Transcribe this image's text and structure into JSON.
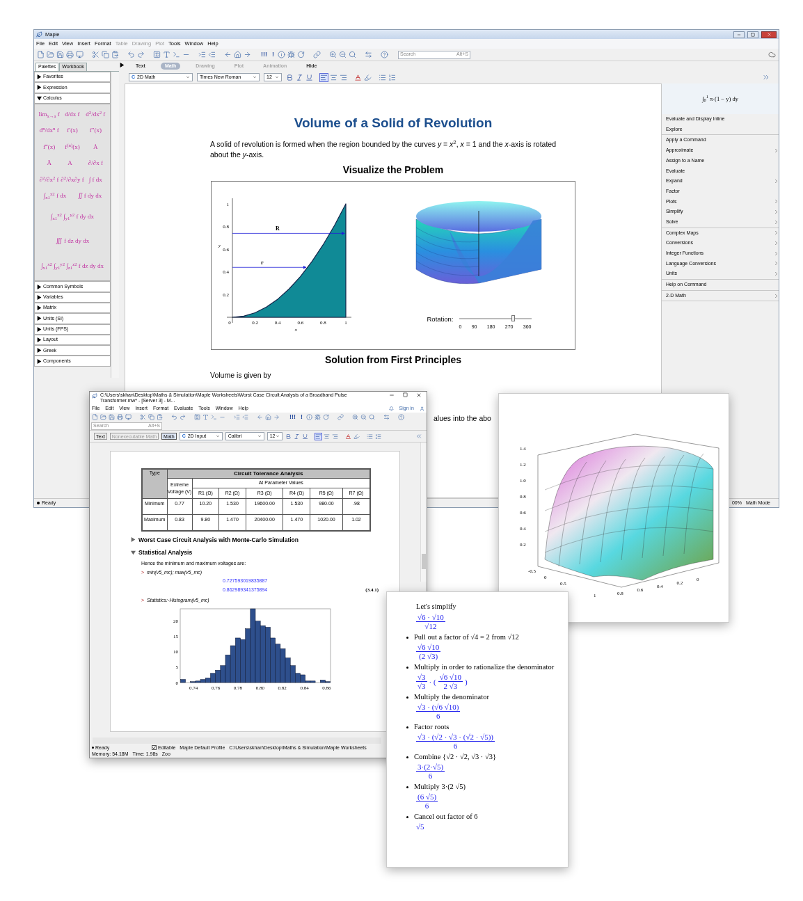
{
  "main_window": {
    "title": "Maple",
    "menu": [
      {
        "label": "File",
        "disabled": false
      },
      {
        "label": "Edit",
        "disabled": false
      },
      {
        "label": "View",
        "disabled": false
      },
      {
        "label": "Insert",
        "disabled": false
      },
      {
        "label": "Format",
        "disabled": false
      },
      {
        "label": "Table",
        "disabled": true
      },
      {
        "label": "Drawing",
        "disabled": true
      },
      {
        "label": "Plot",
        "disabled": true
      },
      {
        "label": "Tools",
        "disabled": false
      },
      {
        "label": "Window",
        "disabled": false
      },
      {
        "label": "Help",
        "disabled": false
      }
    ],
    "toolbar_glyphs": [
      "!!!",
      "!"
    ],
    "search": {
      "placeholder": "Search",
      "shortcut": "Alt+S"
    },
    "panel_tabs": [
      {
        "label": "Palettes",
        "selected": true
      },
      {
        "label": "Workbook",
        "selected": false
      }
    ],
    "mode_tabs": [
      {
        "label": "Text",
        "selected": false,
        "disabled": false
      },
      {
        "label": "Math",
        "selected": true,
        "disabled": false
      },
      {
        "label": "Drawing",
        "selected": false,
        "disabled": true
      },
      {
        "label": "Plot",
        "selected": false,
        "disabled": true
      },
      {
        "label": "Animation",
        "selected": false,
        "disabled": true
      },
      {
        "label": "Hide",
        "selected": false,
        "disabled": false
      }
    ],
    "format_bar": {
      "style_glyph": "C",
      "style": "2D Math",
      "font": "Times New Roman",
      "size": "12"
    },
    "palettes": [
      {
        "label": "Favorites",
        "expanded": false
      },
      {
        "label": "Expression",
        "expanded": false
      },
      {
        "label": "Calculus",
        "expanded": true,
        "items": [
          {
            "kind": "cell",
            "text": "lim$_{x→a}$ f"
          },
          {
            "kind": "cell",
            "text": "d/dx f"
          },
          {
            "kind": "cell",
            "text": "d$^{2}$/dx$^{2}$ f"
          },
          {
            "kind": "cell",
            "text": "d$^{n}$/dx$^{n}$ f"
          },
          {
            "kind": "cell",
            "text": "f′(x)"
          },
          {
            "kind": "cell",
            "text": "f″(x)"
          },
          {
            "kind": "cell",
            "text": "f‴(x)"
          },
          {
            "kind": "cell",
            "text": "f$^{(n)}$(x)"
          },
          {
            "kind": "cell",
            "text": "Ȧ"
          },
          {
            "kind": "cell",
            "text": "Ä"
          },
          {
            "kind": "cell",
            "text": "A⃛"
          },
          {
            "kind": "cell",
            "text": "∂/∂x f"
          },
          {
            "kind": "cell",
            "text": "∂$^{2}$/∂x$^{2}$ f"
          },
          {
            "kind": "cell",
            "text": "∂$^{2}$/∂x∂y f"
          },
          {
            "kind": "cell",
            "text": "∫ f dx"
          },
          {
            "kind": "half",
            "text": "∫$_{x1}$$^{x2}$ f dx"
          },
          {
            "kind": "half",
            "text": "∬ f dy dx"
          },
          {
            "kind": "wide",
            "text": "∫$_{x1}$$^{x2}$ ∫$_{y1}$$^{y2}$ f dy dx"
          },
          {
            "kind": "wide",
            "text": "∭ f dz dy dx"
          },
          {
            "kind": "wide",
            "text": "∫$_{x1}$$^{x2}$ ∫$_{y1}$$^{y2}$ ∫$_{z1}$$^{z2}$ f dz dy dx"
          }
        ]
      },
      {
        "label": "Common Symbols",
        "expanded": false
      },
      {
        "label": "Variables",
        "expanded": false
      },
      {
        "label": "Matrix",
        "expanded": false
      },
      {
        "label": "Units (SI)",
        "expanded": false
      },
      {
        "label": "Units (FPS)",
        "expanded": false
      },
      {
        "label": "Layout",
        "expanded": false
      },
      {
        "label": "Greek",
        "expanded": false
      },
      {
        "label": "Components",
        "expanded": false
      }
    ],
    "document": {
      "title": "Volume of a Solid of Revolution",
      "paragraph": "A solid of revolution is formed when the region bounded by the curves *y* = *x*$^{2}$, *x* = 1 and the *x*-axis is rotated about the *y*-axis.",
      "heading_1": "Visualize the Problem",
      "plot_2d": {
        "chart_data": {
          "type": "area",
          "x": [
            0,
            0.1,
            0.2,
            0.3,
            0.4,
            0.5,
            0.6,
            0.7,
            0.8,
            0.9,
            1
          ],
          "values": [
            0,
            0.01,
            0.04,
            0.09,
            0.16,
            0.25,
            0.36,
            0.49,
            0.64,
            0.81,
            1
          ],
          "xlim": [
            0,
            1
          ],
          "ylim": [
            0,
            1
          ],
          "xlabel": "x",
          "ylabel": "y",
          "xticks": [
            0,
            0.2,
            0.4,
            0.6,
            0.8,
            1
          ],
          "yticks": [
            0.2,
            0.4,
            0.6,
            0.8,
            1
          ],
          "ref_lines": [
            {
              "axis": "y",
              "value": 0.74,
              "label": "R"
            },
            {
              "axis": "y",
              "value": 0.44,
              "label": "r"
            }
          ]
        }
      },
      "rotation": {
        "label": "Rotation:",
        "level": 0.75,
        "ticks": [
          "0",
          "90",
          "180",
          "270",
          "360"
        ]
      },
      "heading_2": "Solution from First Principles",
      "text_1": "Volume is given by",
      "text_2": "alues into the abo"
    },
    "context_panel": {
      "expression": "∫$_{0}$$^{1}$ π·(1 − y) dy",
      "groups": [
        [
          {
            "label": "Evaluate and Display Inline",
            "submenu": false
          },
          {
            "label": "Explore",
            "submenu": false
          }
        ],
        [
          {
            "label": "Apply a Command",
            "submenu": false
          },
          {
            "label": "Approximate",
            "submenu": true
          },
          {
            "label": "Assign to a Name",
            "submenu": false
          },
          {
            "label": "Evaluate",
            "submenu": false
          },
          {
            "label": "Expand",
            "submenu": true
          },
          {
            "label": "Factor",
            "submenu": false
          },
          {
            "label": "Plots",
            "submenu": true
          },
          {
            "label": "Simplify",
            "submenu": true
          },
          {
            "label": "Solve",
            "submenu": true
          }
        ],
        [
          {
            "label": "Complex Maps",
            "submenu": true
          },
          {
            "label": "Conversions",
            "submenu": true
          },
          {
            "label": "Integer Functions",
            "submenu": true
          },
          {
            "label": "Language Conversions",
            "submenu": true
          },
          {
            "label": "Units",
            "submenu": true
          }
        ],
        [
          {
            "label": "Help on Command",
            "submenu": false
          }
        ],
        [
          {
            "label": "2-D Math",
            "submenu": true
          }
        ]
      ]
    },
    "status_bar": {
      "status": "Ready",
      "zoom": "00%",
      "mode": "Math Mode"
    }
  },
  "second_window": {
    "title": "C:\\Users\\skhan\\Desktop\\Maths & Simulation\\Maple Worksheets\\Worst Case Circuit Analysis of a Broadband Pulse Transformer.mw* - [Server 3] - M...",
    "menu": [
      "File",
      "Edit",
      "View",
      "Insert",
      "Format",
      "Evaluate",
      "Tools",
      "Window",
      "Help"
    ],
    "sign_in": "Sign in",
    "toolbar_glyphs": [
      "!!!",
      "!"
    ],
    "search": {
      "placeholder": "Search",
      "shortcut": "Alt+S"
    },
    "mode_buttons": [
      {
        "label": "Text",
        "selected": false,
        "disabled": false
      },
      {
        "label": "Nonexecutable Math",
        "selected": false,
        "disabled": true
      },
      {
        "label": "Math",
        "selected": true,
        "disabled": false
      }
    ],
    "format_bar": {
      "style_glyph": "C",
      "style": "2D Input",
      "font": "Calibri",
      "size": "12"
    },
    "table": {
      "type_header": "Type",
      "title": "Circuit Tolerance Analysis",
      "voltage_header": "Extreme Voltage (V)",
      "params_header": "At Parameter Values",
      "columns": [
        "R1 (Ω)",
        "R2 (Ω)",
        "R3 (Ω)",
        "R4 (Ω)",
        "R5 (Ω)",
        "R7 (Ω)"
      ],
      "rows": [
        {
          "label": "Minimum",
          "voltage": "0.77",
          "values": [
            "10.20",
            "1.530",
            "19600.00",
            "1.530",
            "980.00",
            ".98"
          ]
        },
        {
          "label": "Maximum",
          "voltage": "0.83",
          "values": [
            "9.80",
            "1.470",
            "20400.00",
            "1.470",
            "1020.00",
            "1.02"
          ]
        }
      ]
    },
    "sections": [
      {
        "title": "Worst Case Circuit Analysis with Monte-Carlo Simulation",
        "expanded": false
      },
      {
        "title": "Statistical Analysis",
        "expanded": true
      }
    ],
    "text": "Hence the minimum and maximum voltages are:",
    "command_1": {
      "prompt": ">",
      "code": "min(v5_mc); max(v5_mc)"
    },
    "outputs": [
      "0.727593019835887",
      "0.862989341375894"
    ],
    "equation_label": "(3.4.1)",
    "command_2": {
      "prompt": ">",
      "code": "Statistics:-Histogram(v5_mc)"
    },
    "histogram": {
      "chart_data": {
        "type": "bar",
        "x": [
          0.7305,
          0.735,
          0.7395,
          0.744,
          0.7485,
          0.753,
          0.7575,
          0.762,
          0.7665,
          0.771,
          0.7755,
          0.78,
          0.7845,
          0.789,
          0.7935,
          0.798,
          0.8025,
          0.807,
          0.8115,
          0.816,
          0.8205,
          0.825,
          0.8295,
          0.834,
          0.8385,
          0.843,
          0.8475,
          0.852,
          0.8565,
          0.861
        ],
        "values": [
          1,
          0,
          0.3,
          0.5,
          1,
          1.5,
          3,
          4,
          5.5,
          9,
          12,
          14.5,
          14,
          17.5,
          24,
          20,
          18.5,
          18,
          14.5,
          12.5,
          11,
          8,
          5.5,
          3,
          2.5,
          0.5,
          0.5,
          0,
          0.8,
          0.3
        ],
        "xlim": [
          0.728,
          0.8635
        ],
        "ylim": [
          0,
          24
        ],
        "xticks": [
          {
            "value": 0.74,
            "label": "0.74"
          },
          {
            "value": 0.76,
            "label": "0.76"
          },
          {
            "value": 0.78,
            "label": "0.78"
          },
          {
            "value": 0.8,
            "label": "0.80"
          },
          {
            "value": 0.82,
            "label": "0.82"
          },
          {
            "value": 0.84,
            "label": "0.84"
          },
          {
            "value": 0.86,
            "label": "0.86"
          }
        ],
        "yticks": [
          0,
          5,
          10,
          15,
          20
        ]
      }
    },
    "status_bar": {
      "status": "Ready",
      "editable": {
        "label": "Editable",
        "checked": true
      },
      "profile": "Maple Default Profile",
      "path": "C:\\Users\\skhan\\Desktop\\Maths & Simulation\\Maple Worksheets",
      "memory": "Memory: 54.18M",
      "time": "Time: 1.98s",
      "zoom": "Zoo"
    }
  },
  "plot_3d": {
    "z_ticks": [
      "1.4",
      "1.2",
      "1.0",
      "0.8",
      "0.6",
      "0.4",
      "0.2"
    ],
    "x_ticks": [
      "-0.5",
      "0",
      "0.5",
      "1"
    ],
    "y_ticks": [
      "0.8",
      "0.6",
      "0.4",
      "0.2",
      "0"
    ]
  },
  "derivation": {
    "intro": "Let's simplify",
    "intro_expr": [
      {
        "kind": "frac",
        "num": "√6 · √10",
        "den": "√12"
      }
    ],
    "steps": [
      {
        "text": "Pull out a factor of √4 = 2 from √12",
        "expr": [
          {
            "kind": "frac",
            "num": "√6 √10",
            "den": "(2 √3)"
          }
        ]
      },
      {
        "text": "Multiply in order to rationalize the denominator",
        "expr": [
          {
            "kind": "frac",
            "num": "√3",
            "den": "√3"
          },
          {
            "kind": "text",
            "text": "· ("
          },
          {
            "kind": "frac",
            "num": "√6 √10",
            "den": "2 √3"
          },
          {
            "kind": "text",
            "text": ")"
          }
        ]
      },
      {
        "text": "Multiply the denominator",
        "expr": [
          {
            "kind": "frac",
            "num": "√3 · (√6 √10)",
            "den": "6"
          }
        ]
      },
      {
        "text": "Factor roots",
        "expr": [
          {
            "kind": "frac",
            "num": "√3 · (√2 · √3 · (√2 · √5))",
            "den": "6"
          }
        ]
      },
      {
        "text": "Combine {√2 · √2, √3 · √3}",
        "expr": [
          {
            "kind": "frac",
            "num": "3·(2·√5)",
            "den": "6"
          }
        ]
      },
      {
        "text": "Multiply 3·(2 √5)",
        "expr": [
          {
            "kind": "frac",
            "num": "(6 √5)",
            "den": "6"
          }
        ]
      },
      {
        "text": "Cancel out factor of 6",
        "expr": [
          {
            "kind": "text",
            "text": "√5"
          }
        ]
      }
    ]
  }
}
